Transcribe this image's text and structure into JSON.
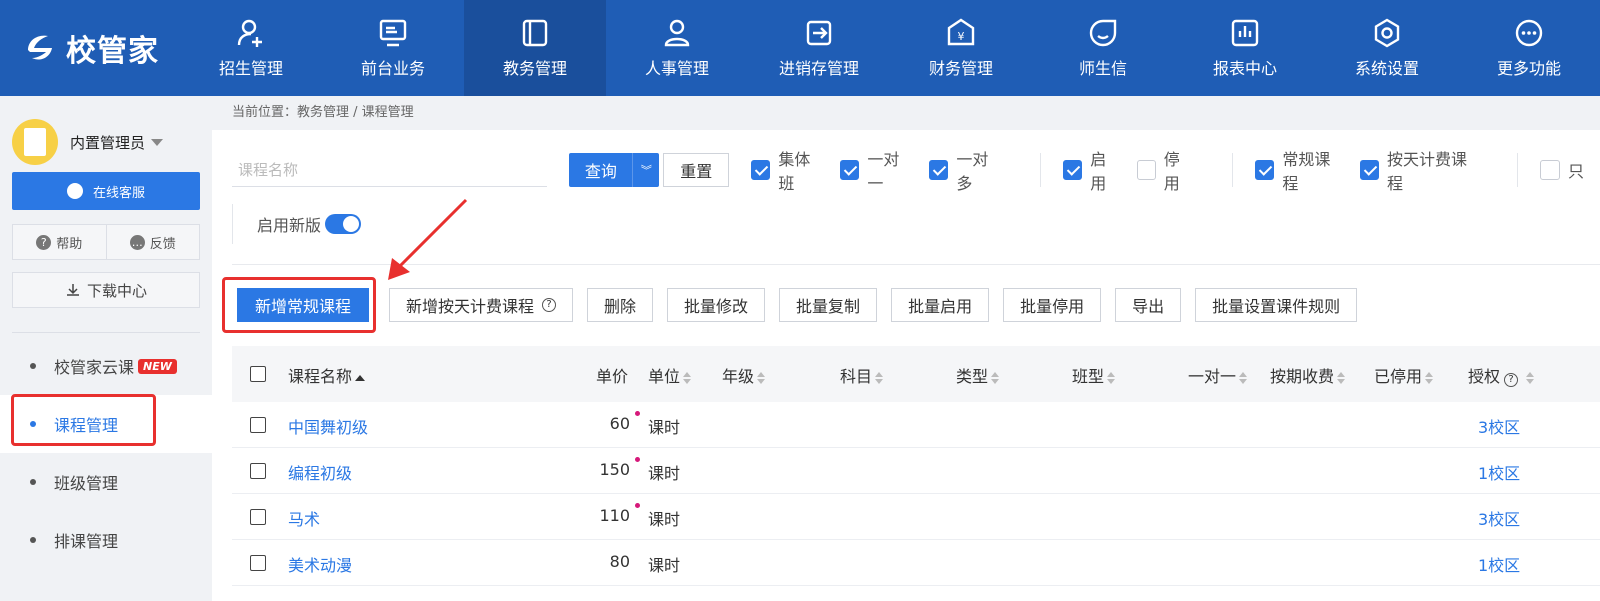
{
  "app": {
    "brand": "校管家",
    "nav": [
      {
        "label": "招生管理",
        "icon": "add-user-icon"
      },
      {
        "label": "前台业务",
        "icon": "monitor-icon"
      },
      {
        "label": "教务管理",
        "icon": "book-icon",
        "active": true
      },
      {
        "label": "人事管理",
        "icon": "person-icon"
      },
      {
        "label": "进销存管理",
        "icon": "export-box-icon"
      },
      {
        "label": "财务管理",
        "icon": "yen-icon"
      },
      {
        "label": "师生信",
        "icon": "chat-icon"
      },
      {
        "label": "报表中心",
        "icon": "bar-chart-icon"
      },
      {
        "label": "系统设置",
        "icon": "gear-icon"
      },
      {
        "label": "更多功能",
        "icon": "more-icon"
      }
    ]
  },
  "sidebar": {
    "user_name": "内置管理员",
    "service_label": "在线客服",
    "help_label": "帮助",
    "feedback_label": "反馈",
    "download_label": "下载中心",
    "menu": [
      {
        "label": "校管家云课",
        "badge": "NEW"
      },
      {
        "label": "课程管理",
        "active": true
      },
      {
        "label": "班级管理"
      },
      {
        "label": "排课管理"
      }
    ]
  },
  "main": {
    "breadcrumb": "当前位置：教务管理 / 课程管理",
    "search_placeholder": "课程名称",
    "query_label": "查询",
    "reset_label": "重置",
    "filters_a": [
      {
        "label": "集体班",
        "checked": true
      },
      {
        "label": "一对一",
        "checked": true
      },
      {
        "label": "一对多",
        "checked": true
      }
    ],
    "filters_b": [
      {
        "label": "启用",
        "checked": true
      },
      {
        "label": "停用",
        "checked": false
      }
    ],
    "filters_c": [
      {
        "label": "常规课程",
        "checked": true
      },
      {
        "label": "按天计费课程",
        "checked": true
      }
    ],
    "filters_d": [
      {
        "label": "只",
        "checked": false
      }
    ],
    "new_version_label": "启用新版",
    "actions": {
      "add_regular": "新增常规课程",
      "add_daily": "新增按天计费课程",
      "delete": "删除",
      "batch_edit": "批量修改",
      "batch_copy": "批量复制",
      "batch_enable": "批量启用",
      "batch_disable": "批量停用",
      "export": "导出",
      "batch_rules": "批量设置课件规则"
    },
    "table": {
      "headers": {
        "name": "课程名称",
        "price": "单价",
        "unit": "单位",
        "grade": "年级",
        "subject": "科目",
        "type": "类型",
        "class_type": "班型",
        "one_on_one": "一对一",
        "periodic": "按期收费",
        "disabled": "已停用",
        "auth": "授权"
      },
      "rows": [
        {
          "name": "中国舞初级",
          "price": "60",
          "unit": "课时",
          "auth": "3校区",
          "dot": true
        },
        {
          "name": "编程初级",
          "price": "150",
          "unit": "课时",
          "auth": "1校区",
          "dot": true
        },
        {
          "name": "马术",
          "price": "110",
          "unit": "课时",
          "auth": "3校区",
          "dot": true
        },
        {
          "name": "美术动漫",
          "price": "80",
          "unit": "课时",
          "auth": "1校区",
          "dot": false
        }
      ]
    }
  },
  "colors": {
    "primary": "#2b78e4",
    "nav_bg": "#1f5db5",
    "highlight": "#e8302e"
  }
}
